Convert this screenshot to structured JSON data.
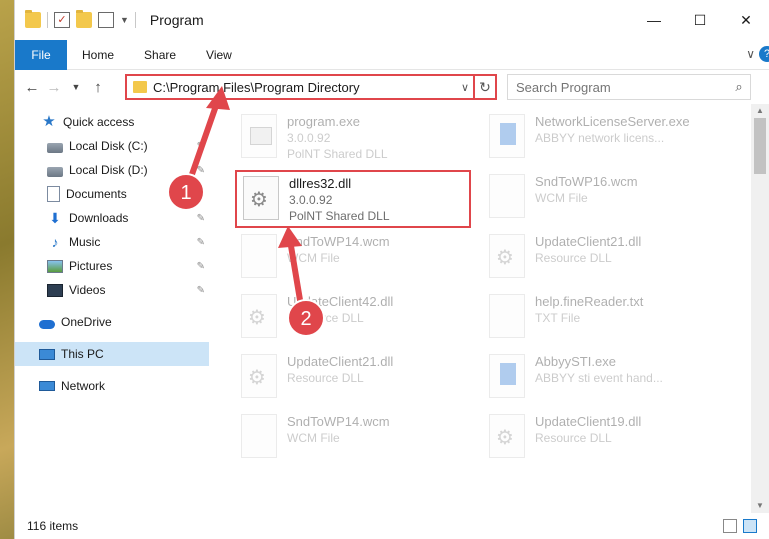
{
  "window": {
    "title": "Program",
    "controls": [
      "minimize",
      "maximize",
      "close"
    ]
  },
  "quick_access_toolbar": [
    "folder-icon",
    "properties-check-icon",
    "new-folder-icon",
    "customize-icon"
  ],
  "ribbon": {
    "tabs": [
      "File",
      "Home",
      "Share",
      "View"
    ],
    "expand_glyph": "∨",
    "help_glyph": "?"
  },
  "navigation": {
    "address": "C:\\Program Files\\Program Directory",
    "search_placeholder": "Search Program"
  },
  "sidebar": {
    "items": [
      {
        "label": "Quick access",
        "icon": "star-icon",
        "pinned": false
      },
      {
        "label": "Local Disk (C:)",
        "icon": "disk-icon",
        "pinned": true
      },
      {
        "label": "Local Disk (D:)",
        "icon": "disk-icon",
        "pinned": true
      },
      {
        "label": "Documents",
        "icon": "documents-icon",
        "pinned": true
      },
      {
        "label": "Downloads",
        "icon": "downloads-icon",
        "pinned": true
      },
      {
        "label": "Music",
        "icon": "music-icon",
        "pinned": true
      },
      {
        "label": "Pictures",
        "icon": "pictures-icon",
        "pinned": true
      },
      {
        "label": "Videos",
        "icon": "videos-icon",
        "pinned": true
      },
      {
        "label": "OneDrive",
        "icon": "onedrive-icon",
        "pinned": false
      },
      {
        "label": "This PC",
        "icon": "this-pc-icon",
        "pinned": false,
        "selected": true
      },
      {
        "label": "Network",
        "icon": "network-icon",
        "pinned": false
      }
    ]
  },
  "files": {
    "left_column": [
      {
        "name": "program.exe",
        "version": "3.0.0.92",
        "type": "PolNT Shared DLL",
        "icon": "exe-icon"
      },
      {
        "name": "dllres32.dll",
        "version": "3.0.0.92",
        "type": "PolNT Shared DLL",
        "icon": "dll-gear-icon",
        "highlighted": true
      },
      {
        "name": "SndToWP14.wcm",
        "version": "",
        "type": "WCM File",
        "icon": "file-icon"
      },
      {
        "name": "UpdateClient42.dll",
        "version": "",
        "type": "Resource DLL",
        "icon": "dll-gear-icon"
      },
      {
        "name": "UpdateClient21.dll",
        "version": "",
        "type": "Resource DLL",
        "icon": "dll-gear-icon"
      },
      {
        "name": "SndToWP14.wcm",
        "version": "",
        "type": "WCM File",
        "icon": "file-icon"
      }
    ],
    "right_column": [
      {
        "name": "NetworkLicenseServer.exe",
        "version": "",
        "type": "ABBYY network licens...",
        "icon": "blue-exe-icon"
      },
      {
        "name": "SndToWP16.wcm",
        "version": "",
        "type": "WCM File",
        "icon": "file-icon"
      },
      {
        "name": "UpdateClient21.dll",
        "version": "",
        "type": "Resource DLL",
        "icon": "dll-gear-icon"
      },
      {
        "name": "help.fineReader.txt",
        "version": "",
        "type": "TXT File",
        "icon": "file-icon"
      },
      {
        "name": "AbbyySTI.exe",
        "version": "",
        "type": "ABBYY sti event hand...",
        "icon": "blue-exe-icon"
      },
      {
        "name": "UpdateClient19.dll",
        "version": "",
        "type": "Resource DLL",
        "icon": "dll-gear-icon"
      }
    ]
  },
  "status_bar": {
    "item_count": "116 items"
  },
  "annotations": {
    "marker_1": "1",
    "marker_2": "2",
    "accent": "#e0464b"
  },
  "colors": {
    "file_tab": "#1979ca",
    "selection": "#cce4f7",
    "highlight_box": "#e0464b"
  }
}
